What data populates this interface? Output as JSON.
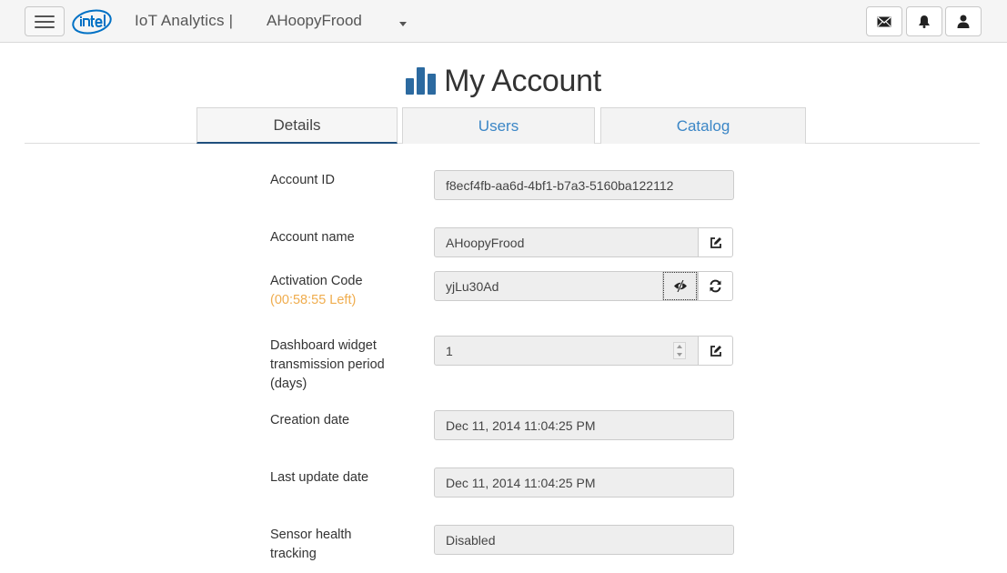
{
  "header": {
    "app_title": "IoT Analytics |",
    "account_selector": "AHoopyFrood"
  },
  "page": {
    "title": "My Account"
  },
  "tabs": [
    {
      "label": "Details",
      "active": true
    },
    {
      "label": "Users",
      "active": false
    },
    {
      "label": "Catalog",
      "active": false
    }
  ],
  "form": {
    "account_id": {
      "label": "Account ID",
      "value": "f8ecf4fb-aa6d-4bf1-b7a3-5160ba122112"
    },
    "account_name": {
      "label": "Account name",
      "value": "AHoopyFrood"
    },
    "activation_code": {
      "label": "Activation Code",
      "sublabel": "(00:58:55 Left)",
      "value": "yjLu30Ad"
    },
    "widget_period": {
      "label_lines": [
        "Dashboard widget",
        "transmission period",
        "(days)"
      ],
      "value": "1"
    },
    "creation_date": {
      "label": "Creation date",
      "value": "Dec 11, 2014 11:04:25 PM"
    },
    "last_update_date": {
      "label": "Last update date",
      "value": "Dec 11, 2014 11:04:25 PM"
    },
    "sensor_health": {
      "label_lines": [
        "Sensor health",
        "tracking"
      ],
      "value": "Disabled"
    }
  },
  "colors": {
    "accent": "#3b86c6",
    "logo_blue": "#0071c5",
    "warning": "#f0ad4e",
    "tab_active_border": "#1f4f7d"
  },
  "icons": {
    "menu": "hamburger-icon",
    "logo": "intel-logo",
    "mail": "envelope-icon",
    "notifications": "bell-icon",
    "user": "user-icon",
    "title": "bar-chart-icon",
    "edit": "edit-icon",
    "visibility": "eye-slash-icon",
    "refresh": "refresh-icon"
  }
}
